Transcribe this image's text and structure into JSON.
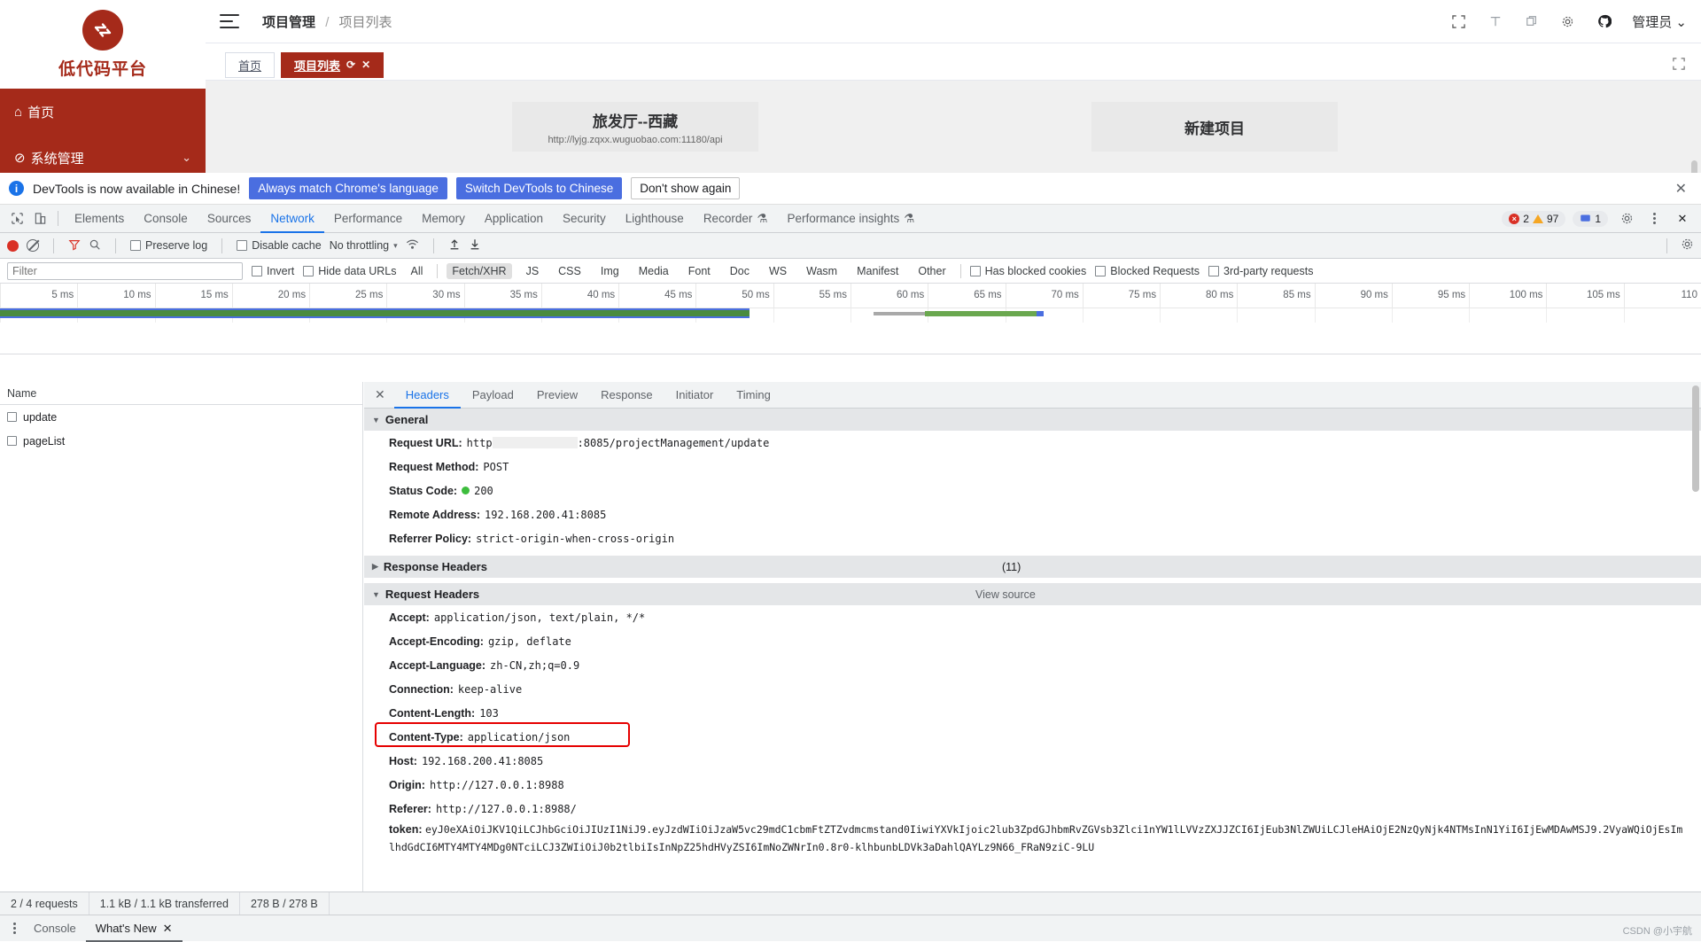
{
  "app": {
    "brand": {
      "logo_icon": "swap-circle-logo",
      "name": "低代码平台"
    },
    "menu": [
      {
        "icon": "home-icon",
        "label": "首页",
        "caret": ""
      },
      {
        "icon": "settings-slash-icon",
        "label": "系统管理",
        "caret": "⌄"
      }
    ],
    "header": {
      "hamburger_icon": "hamburger-icon",
      "breadcrumb_current": "项目管理",
      "breadcrumb_sep": "/",
      "breadcrumb_sub": "项目列表",
      "icons": [
        "fullscreen-icon",
        "text-size-icon",
        "copy-icon",
        "gear-icon",
        "github-icon"
      ],
      "user": "管理员",
      "user_caret": "⌄"
    },
    "tabs": [
      {
        "label": "首页",
        "active": false
      },
      {
        "label": "项目列表",
        "active": true,
        "refresh_icon": "refresh-icon",
        "close_icon": "close-icon"
      }
    ],
    "tabbar_right": {
      "caret_icon": "chevron-down-icon",
      "expand_icon": "expand-icon"
    },
    "cards": {
      "project": {
        "title": "旅发厅--西藏",
        "url": "http://lyjg.zqxx.wuguobao.com:11180/api"
      },
      "new": {
        "title": "新建项目"
      }
    }
  },
  "devtools": {
    "banner": {
      "info_icon": "info-icon",
      "message": "DevTools is now available in Chinese!",
      "btn_always": "Always match Chrome's language",
      "btn_switch": "Switch DevTools to Chinese",
      "btn_dismiss": "Don't show again",
      "close_icon": "close-icon"
    },
    "tabs": [
      {
        "label": "Elements",
        "active": false
      },
      {
        "label": "Console",
        "active": false
      },
      {
        "label": "Sources",
        "active": false
      },
      {
        "label": "Network",
        "active": true
      },
      {
        "label": "Performance",
        "active": false
      },
      {
        "label": "Memory",
        "active": false
      },
      {
        "label": "Application",
        "active": false
      },
      {
        "label": "Security",
        "active": false
      },
      {
        "label": "Lighthouse",
        "active": false
      },
      {
        "label": "Recorder",
        "active": false,
        "beaker": "⚗"
      },
      {
        "label": "Performance insights",
        "active": false,
        "beaker": "⚗"
      }
    ],
    "badges": {
      "errors": "2",
      "warnings": "97",
      "messages": "1"
    },
    "tabs_right_icons": [
      "gear-icon",
      "kebab-icon",
      "close-icon"
    ],
    "toolbar": {
      "record_icon": "record-icon",
      "clear_icon": "clear-icon",
      "filter_icon": "filter-icon",
      "search_icon": "search-icon",
      "preserve_log": "Preserve log",
      "disable_cache": "Disable cache",
      "throttling": "No throttling",
      "throttling_caret": "▾",
      "wifi_icon": "wifi-settings-icon",
      "import_icon": "import-har-icon",
      "export_icon": "export-har-icon",
      "settings_icon": "network-settings-icon"
    },
    "filterbar": {
      "filter_placeholder": "Filter",
      "filter_value": "",
      "invert": "Invert",
      "hide_data_urls": "Hide data URLs",
      "types": [
        "All",
        "Fetch/XHR",
        "JS",
        "CSS",
        "Img",
        "Media",
        "Font",
        "Doc",
        "WS",
        "Wasm",
        "Manifest",
        "Other"
      ],
      "selected_type": "Fetch/XHR",
      "has_blocked_cookies": "Has blocked cookies",
      "blocked_requests": "Blocked Requests",
      "third_party": "3rd-party requests"
    },
    "timeline_ticks": [
      "5 ms",
      "10 ms",
      "15 ms",
      "20 ms",
      "25 ms",
      "30 ms",
      "35 ms",
      "40 ms",
      "45 ms",
      "50 ms",
      "55 ms",
      "60 ms",
      "65 ms",
      "70 ms",
      "75 ms",
      "80 ms",
      "85 ms",
      "90 ms",
      "95 ms",
      "100 ms",
      "105 ms",
      "110"
    ],
    "request_list": {
      "column": "Name",
      "rows": [
        {
          "name": "update",
          "selected": true
        },
        {
          "name": "pageList",
          "selected": false
        }
      ]
    },
    "detail": {
      "close_icon": "close-icon",
      "tabs": [
        "Headers",
        "Payload",
        "Preview",
        "Response",
        "Initiator",
        "Timing"
      ],
      "active_tab": "Headers",
      "general": {
        "title": "General",
        "items": [
          {
            "key": "Request URL:",
            "value": "http",
            "redacted": true,
            "value_tail": ":8085/projectManagement/update"
          },
          {
            "key": "Request Method:",
            "value": "POST"
          },
          {
            "key": "Status Code:",
            "value": "200",
            "status_dot": "#3dbd3d"
          },
          {
            "key": "Remote Address:",
            "value": "192.168.200.41:8085"
          },
          {
            "key": "Referrer Policy:",
            "value": "strict-origin-when-cross-origin"
          }
        ]
      },
      "response_headers": {
        "title": "Response Headers",
        "count": "(11)",
        "collapsed": true
      },
      "request_headers": {
        "title": "Request Headers",
        "view_source": "View source",
        "items": [
          {
            "key": "Accept:",
            "value": "application/json, text/plain, */*"
          },
          {
            "key": "Accept-Encoding:",
            "value": "gzip, deflate"
          },
          {
            "key": "Accept-Language:",
            "value": "zh-CN,zh;q=0.9"
          },
          {
            "key": "Connection:",
            "value": "keep-alive"
          },
          {
            "key": "Content-Length:",
            "value": "103"
          },
          {
            "key": "Content-Type:",
            "value": "application/json",
            "highlight": true
          },
          {
            "key": "Host:",
            "value": "192.168.200.41:8085"
          },
          {
            "key": "Origin:",
            "value": "http://127.0.0.1:8988"
          },
          {
            "key": "Referer:",
            "value": "http://127.0.0.1:8988/"
          }
        ],
        "token_key": "token:",
        "token_value": "eyJ0eXAiOiJKV1QiLCJhbGciOiJIUzI1NiJ9.eyJzdWIiOiJzaW5vc29mdC1cbmFtZTZvdmcmstand0IiwiYXVkIjoic2lub3ZpdGJhbmRvZGVsb3Zlci1nYW1lLVVzZXJJZCI6IjEub3NlZWUiLCJleHAiOjE2NzQyNjk4NTMsInN1YiI6IjEwMDAwMSJ9.2VyaWQiOjEsImlhdGdCI6MTY4MTY4MDg0NTciLCJ3ZWIiOiJ0b2tlbiIsInNpZ25hdHVyZSI6ImNoZWNrIn0.8r0-klhbunbLDVk3aDahlQAYLz9N66_FRaN9ziC-9LU"
      }
    },
    "status_bar": {
      "requests": "2 / 4 requests",
      "transferred": "1.1 kB / 1.1 kB transferred",
      "resources": "278 B / 278 B"
    },
    "drawer": {
      "kebab_icon": "kebab-icon",
      "tabs": [
        {
          "label": "Console",
          "active": false
        },
        {
          "label": "What's New",
          "active": true,
          "close_icon": "close-icon"
        }
      ]
    },
    "watermark": "CSDN @小宇航"
  }
}
